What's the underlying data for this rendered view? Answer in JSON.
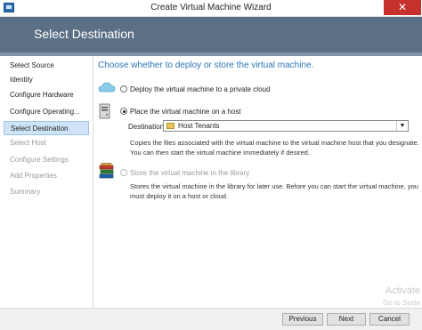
{
  "window": {
    "title": "Create Virtual Machine Wizard",
    "close_glyph": "✕"
  },
  "header": {
    "title": "Select Destination"
  },
  "sidebar": {
    "items": [
      {
        "label": "Select Source",
        "state": "normal"
      },
      {
        "label": "Identity",
        "state": "normal"
      },
      {
        "label": "Configure Hardware",
        "state": "normal"
      },
      {
        "label": "Configure Operating...",
        "state": "normal"
      },
      {
        "label": "Select Destination",
        "state": "selected"
      },
      {
        "label": "Select Host",
        "state": "disabled"
      },
      {
        "label": "Configure Settings",
        "state": "disabled"
      },
      {
        "label": "Add Properties",
        "state": "disabled"
      },
      {
        "label": "Summary",
        "state": "disabled"
      }
    ]
  },
  "main": {
    "heading": "Choose whether to deploy or store the virtual machine.",
    "options": {
      "cloud": {
        "label": "Deploy the virtual machine to a private cloud",
        "icon": "cloud-icon",
        "checked": false
      },
      "host": {
        "label": "Place the virtual machine on a host",
        "icon": "server-icon",
        "checked": true,
        "destination_label": "Destination:",
        "destination_value": "Host Tenants",
        "description_1": "Copies the files associated with the virtual machine to the virtual machine host that you designate.",
        "description_2": "You can then start the virtual machine immediately if desired."
      },
      "library": {
        "label": "Store the virtual machine in the library",
        "icon": "library-books-icon",
        "checked": false,
        "disabled": true,
        "description_1": "Stores the virtual machine in the library for later use. Before you can start the virtual machine, you",
        "description_2": "must deploy it on a host or cloud."
      }
    }
  },
  "footer": {
    "previous": "Previous",
    "next": "Next",
    "cancel": "Cancel"
  },
  "watermark": {
    "line1": "Activate",
    "line2": "Go to Syste"
  },
  "colors": {
    "header_bg": "#5b6f85",
    "accent": "#2e75b6",
    "selected_bg": "#cfe3f7",
    "close_bg": "#c7312b"
  }
}
